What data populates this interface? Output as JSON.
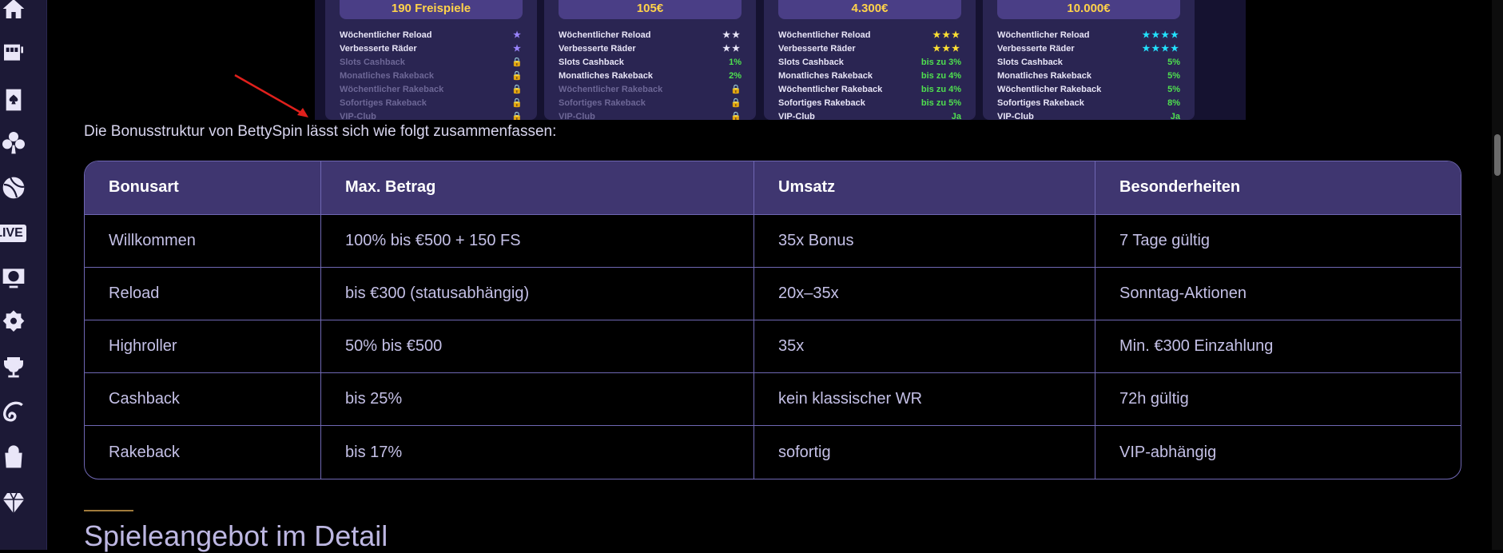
{
  "sidebar": {
    "icons": [
      "home-icon",
      "slot-machine-icon",
      "card-spade-icon",
      "clover-icon",
      "basketball-icon",
      "live-icon",
      "tv-icon",
      "badge-icon",
      "trophy-icon",
      "swirl-icon",
      "shopping-bag-icon",
      "diamond-icon"
    ],
    "live_label": "LIVE"
  },
  "promo": {
    "cards": [
      {
        "banner": "190 Freispiele",
        "rows": [
          {
            "label": "Wöchentlicher Reload",
            "value": "★",
            "style": "star-purple",
            "dim": false
          },
          {
            "label": "Verbesserte Räder",
            "value": "★",
            "style": "star-purple",
            "dim": false
          },
          {
            "label": "Slots Cashback",
            "value": "🔒",
            "style": "lock",
            "dim": true
          },
          {
            "label": "Monatliches Rakeback",
            "value": "🔒",
            "style": "lock",
            "dim": true
          },
          {
            "label": "Wöchentlicher Rakeback",
            "value": "🔒",
            "style": "lock",
            "dim": true
          },
          {
            "label": "Sofortiges Rakeback",
            "value": "🔒",
            "style": "lock",
            "dim": true
          },
          {
            "label": "VIP-Club",
            "value": "🔒",
            "style": "lock",
            "dim": true
          }
        ]
      },
      {
        "banner": "105€",
        "rows": [
          {
            "label": "Wöchentlicher Reload",
            "value": "★★",
            "style": "star-white",
            "dim": false
          },
          {
            "label": "Verbesserte Räder",
            "value": "★★",
            "style": "star-white",
            "dim": false
          },
          {
            "label": "Slots Cashback",
            "value": "1%",
            "style": "green",
            "dim": false
          },
          {
            "label": "Monatliches Rakeback",
            "value": "2%",
            "style": "green",
            "dim": false
          },
          {
            "label": "Wöchentlicher Rakeback",
            "value": "🔒",
            "style": "lock",
            "dim": true
          },
          {
            "label": "Sofortiges Rakeback",
            "value": "🔒",
            "style": "lock",
            "dim": true
          },
          {
            "label": "VIP-Club",
            "value": "🔒",
            "style": "lock",
            "dim": true
          }
        ]
      },
      {
        "banner": "4.300€",
        "rows": [
          {
            "label": "Wöchentlicher Reload",
            "value": "★★★",
            "style": "star-yellow",
            "dim": false
          },
          {
            "label": "Verbesserte Räder",
            "value": "★★★",
            "style": "star-yellow",
            "dim": false
          },
          {
            "label": "Slots Cashback",
            "value": "bis zu 3%",
            "style": "green",
            "dim": false
          },
          {
            "label": "Monatliches Rakeback",
            "value": "bis zu 4%",
            "style": "green",
            "dim": false
          },
          {
            "label": "Wöchentlicher Rakeback",
            "value": "bis zu 4%",
            "style": "green",
            "dim": false
          },
          {
            "label": "Sofortiges Rakeback",
            "value": "bis zu 5%",
            "style": "green",
            "dim": false
          },
          {
            "label": "VIP-Club",
            "value": "Ja",
            "style": "green",
            "dim": false
          }
        ]
      },
      {
        "banner": "10.000€",
        "rows": [
          {
            "label": "Wöchentlicher Reload",
            "value": "★★★★",
            "style": "star-cyan",
            "dim": false
          },
          {
            "label": "Verbesserte Räder",
            "value": "★★★★",
            "style": "star-cyan",
            "dim": false
          },
          {
            "label": "Slots Cashback",
            "value": "5%",
            "style": "green",
            "dim": false
          },
          {
            "label": "Monatliches Rakeback",
            "value": "5%",
            "style": "green",
            "dim": false
          },
          {
            "label": "Wöchentlicher Rakeback",
            "value": "5%",
            "style": "green",
            "dim": false
          },
          {
            "label": "Sofortiges Rakeback",
            "value": "8%",
            "style": "green",
            "dim": false
          },
          {
            "label": "VIP-Club",
            "value": "Ja",
            "style": "green",
            "dim": false
          }
        ]
      }
    ]
  },
  "intro_text": "Die Bonusstruktur von BettySpin lässt sich wie folgt zusammenfassen:",
  "table": {
    "headers": [
      "Bonusart",
      "Max. Betrag",
      "Umsatz",
      "Besonderheiten"
    ],
    "rows": [
      [
        "Willkommen",
        "100% bis €500 + 150 FS",
        "35x Bonus",
        "7 Tage gültig"
      ],
      [
        "Reload",
        "bis €300 (statusabhängig)",
        "20x–35x",
        "Sonntag-Aktionen"
      ],
      [
        "Highroller",
        "50% bis €500",
        "35x",
        "Min. €300 Einzahlung"
      ],
      [
        "Cashback",
        "bis 25%",
        "kein klassischer WR",
        "72h gültig"
      ],
      [
        "Rakeback",
        "bis 17%",
        "sofortig",
        "VIP-abhängig"
      ]
    ]
  },
  "section_title": "Spieleangebot im Detail",
  "colors": {
    "table_header_bg": "#3f3670",
    "table_border": "#6f67b3",
    "sidebar_bg": "#1c1936",
    "accent_gold": "#a07b3b"
  }
}
